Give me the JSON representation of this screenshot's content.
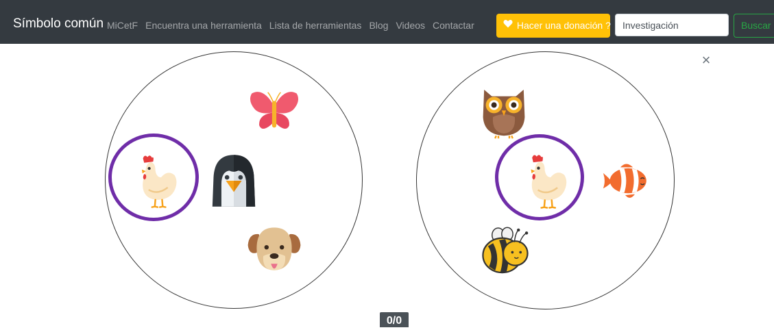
{
  "navbar": {
    "brand": "Símbolo común",
    "links": [
      "MiCetF",
      "Encuentra una herramienta",
      "Lista de herramientas",
      "Blog",
      "Videos",
      "Contactar"
    ],
    "donate_label": "Hacer una donación ?",
    "donate_icon": "heart-icon",
    "search_value": "Investigación",
    "search_button": "Buscar"
  },
  "close_label": "×",
  "game": {
    "score": "0/0",
    "left_card": [
      "butterfly",
      "chicken",
      "penguin",
      "dog"
    ],
    "right_card": [
      "owl",
      "chicken",
      "clownfish",
      "bee"
    ],
    "highlighted_symbol": "chicken"
  },
  "colors": {
    "navbar": "#343a40",
    "donate": "#ffc107",
    "search_button": "#28a745",
    "highlight_ring": "#6f2da8"
  }
}
